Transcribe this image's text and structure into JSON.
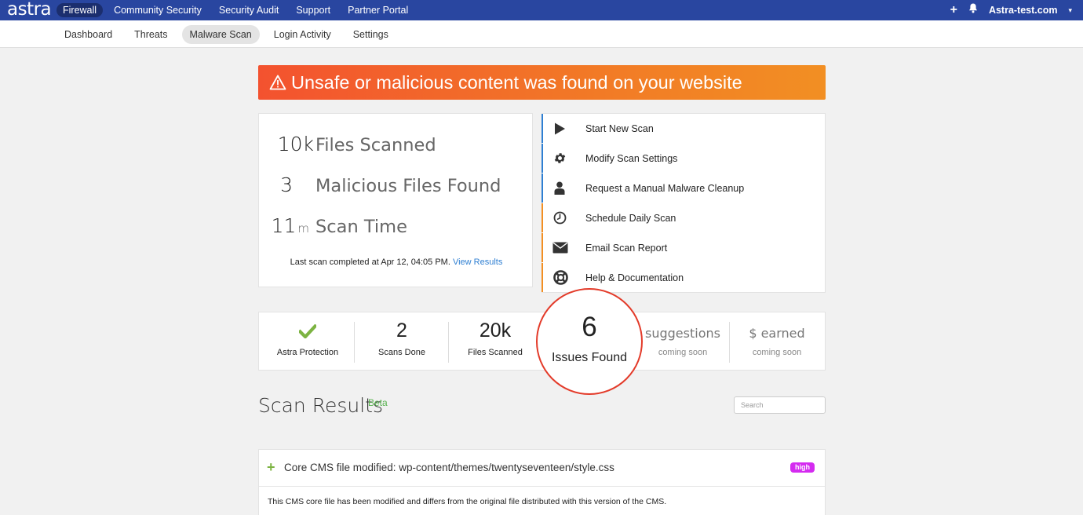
{
  "topbar": {
    "logo": "astra",
    "nav": [
      "Firewall",
      "Community Security",
      "Security Audit",
      "Support",
      "Partner Portal"
    ],
    "active_nav": "Firewall",
    "plus_icon": "+",
    "domain": "Astra-test.com",
    "caret": "▾"
  },
  "subnav": {
    "items": [
      "Dashboard",
      "Threats",
      "Malware Scan",
      "Login Activity",
      "Settings"
    ],
    "active": "Malware Scan"
  },
  "alert": {
    "message": "Unsafe or malicious content was found on your website",
    "icon": "warning-triangle-icon",
    "gradient_start": "#f3522f",
    "gradient_end": "#f28f23"
  },
  "stats": {
    "files_scanned": {
      "value": "10k",
      "label": "Files Scanned"
    },
    "malicious": {
      "value": "3",
      "label": "Malicious Files Found"
    },
    "scan_time": {
      "value": "11",
      "unit": "m",
      "label": "Scan Time"
    },
    "last_scan_text": "Last scan completed at Apr 12, 04:05 PM.",
    "view_results": "View Results"
  },
  "actions": {
    "items": [
      {
        "label": "Start New Scan",
        "icon": "play-icon"
      },
      {
        "label": "Modify Scan Settings",
        "icon": "gear-icon"
      },
      {
        "label": "Request a Manual Malware Cleanup",
        "icon": "user-icon"
      },
      {
        "label": "Schedule Daily Scan",
        "icon": "clock-icon"
      },
      {
        "label": "Email Scan Report",
        "icon": "envelope-icon"
      },
      {
        "label": "Help & Documentation",
        "icon": "lifebuoy-icon"
      }
    ],
    "accent_blue": "#2f7fd2",
    "accent_orange": "#f28f23"
  },
  "metrics": {
    "protection": {
      "label": "Astra Protection",
      "icon": "check-icon",
      "color": "#7cb342"
    },
    "scans_done": {
      "value": "2",
      "label": "Scans Done"
    },
    "files_scanned": {
      "value": "20k",
      "label": "Files Scanned"
    },
    "issues": {
      "value": "6",
      "label": "Issues Found"
    },
    "suggestions": {
      "value": "suggestions",
      "label": "coming soon"
    },
    "earned": {
      "value": "$ earned",
      "label": "coming soon"
    }
  },
  "results": {
    "title": "Scan Results",
    "beta": "Beta",
    "search_placeholder": "Search",
    "issue": {
      "expand": "+",
      "title": "Core CMS file modified: wp-content/themes/twentyseventeen/style.css",
      "severity": "high",
      "severity_color": "#d42bf0",
      "description": "This CMS core file has been modified and differs from the original file distributed with this version of the CMS."
    }
  }
}
